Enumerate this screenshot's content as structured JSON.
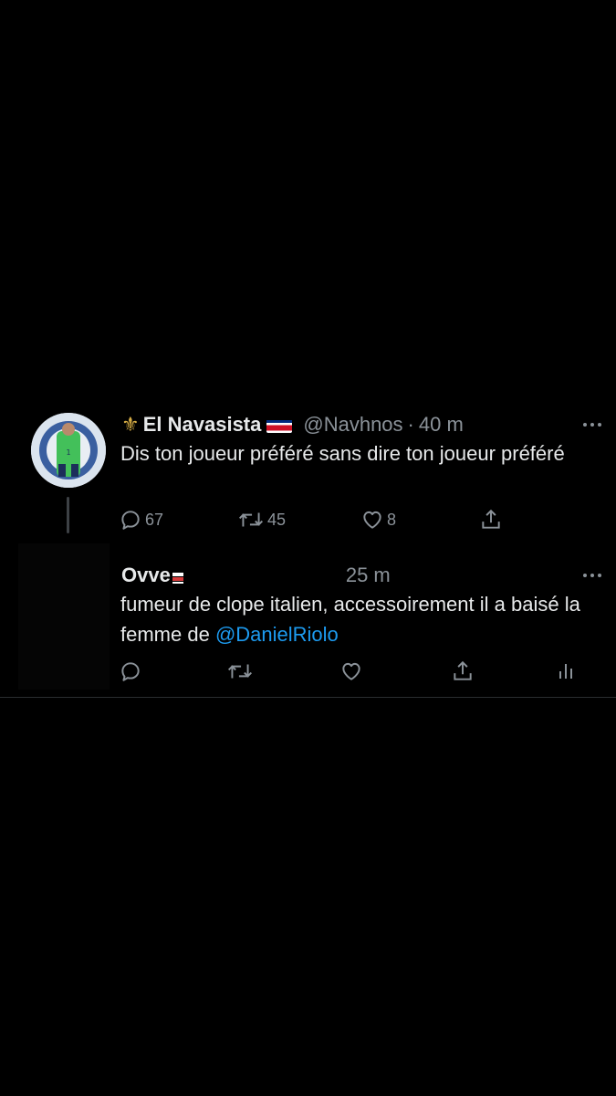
{
  "tweets": [
    {
      "display_name": "El Navasista",
      "name_prefix_icon": "fleur-de-lis-icon",
      "flag": "costa-rica-flag",
      "handle": "@Navhnos",
      "separator": "·",
      "time": "40 m",
      "text": "Dis ton joueur préféré sans dire ton joueur préféré",
      "reply_count": "67",
      "retweet_count": "45",
      "like_count": "8"
    },
    {
      "display_name": "Ovve",
      "time": "25 m",
      "text_before_mention": "fumeur de clope italien, accessoirement il a baisé la femme de ",
      "mention": "@DanielRiolo"
    }
  ],
  "colors": {
    "background": "#000000",
    "text": "#e7e9ea",
    "secondary": "#8b9299",
    "mention": "#1d9bf0",
    "thread_line": "#3d4145"
  }
}
